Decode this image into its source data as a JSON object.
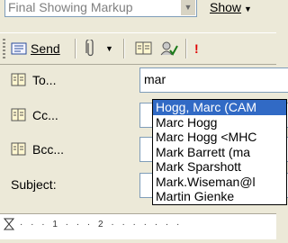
{
  "toolbar_top": {
    "markup_combo_value": "Final Showing Markup",
    "show_label": "Show"
  },
  "toolbar": {
    "send_label": "Send",
    "importance_glyph": "!"
  },
  "address": {
    "to_label": "To...",
    "cc_label": "Cc...",
    "bcc_label": "Bcc...",
    "subject_label": "Subject:",
    "to_value": "mar"
  },
  "autocomplete": {
    "items": [
      "Hogg, Marc (CAM",
      "Marc Hogg",
      "Marc Hogg  <MHC",
      "Mark Barrett (ma",
      "Mark Sparshott",
      "Mark.Wiseman@l",
      "Martin Gienke"
    ],
    "selected_index": 0
  },
  "ruler": {
    "marks": "· · · 1 · · · 2 · · · · · · ·"
  },
  "colors": {
    "chrome": "#ece9d8",
    "selection": "#316ac5",
    "importance": "#e00000"
  }
}
